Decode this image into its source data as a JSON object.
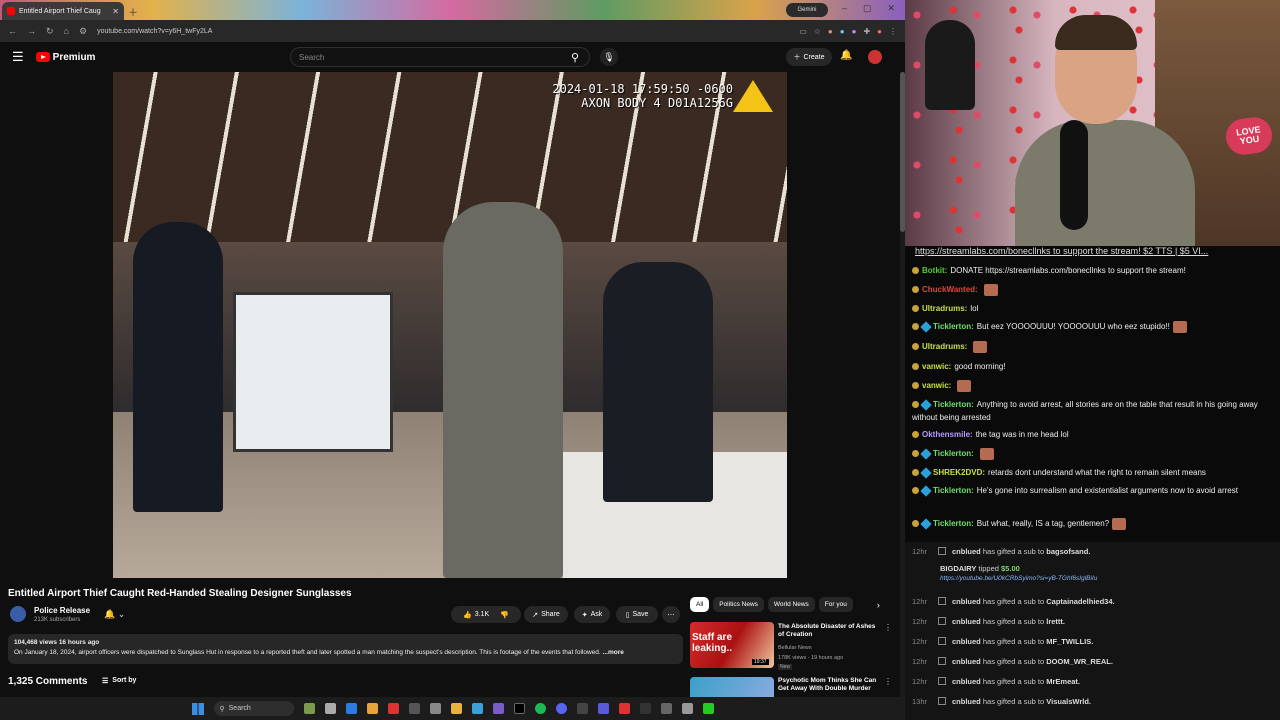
{
  "browser": {
    "tab_title": "Entitled Airport Thief Caug",
    "url": "youtube.com/watch?v=y6H_twFy2LA",
    "gemini_label": "Gemini"
  },
  "youtube": {
    "brand": "Premium",
    "search_placeholder": "Search",
    "create_label": "Create",
    "video": {
      "timestamp_line1": "2024-01-18 17:59:50 -0600",
      "timestamp_line2": "AXON BODY 4 D01A1256G",
      "title": "Entitled Airport Thief Caught Red-Handed Stealing Designer Sunglasses"
    },
    "channel": {
      "name": "Police Release",
      "subs": "213K subscribers"
    },
    "actions": {
      "likes": "3.1K",
      "share": "Share",
      "ask": "Ask",
      "save": "Save"
    },
    "description": {
      "meta": "104,468 views  16 hours ago",
      "text": "On January 18, 2024, airport officers were dispatched to Sunglass Hut in response to a reported theft and later spotted a man matching the suspect's description. This is footage of the events that followed.",
      "more": "...more"
    },
    "comments_count": "1,325 Comments",
    "sort_by": "Sort by",
    "chips": [
      "All",
      "Politics News",
      "World News",
      "For you"
    ],
    "recs": [
      {
        "thumb_text": "Staff are leaking..",
        "duration": "19:37",
        "title": "The Absolute Disaster of Ashes of Creation",
        "channel": "Bellular News",
        "meta": "178K views · 19 hours ago",
        "badge": "New"
      },
      {
        "title": "Psychotic Mom Thinks She Can Get Away With Double Murder"
      }
    ]
  },
  "overlay": {
    "love_sign": "LOVE YOU"
  },
  "chat": {
    "ticker": "https://streamlabs.com/bonecllnks to support the stream! $2 TTS | $5 VI...",
    "messages": [
      {
        "user": "Botkit:",
        "text": "DONATE https://streamlabs.com/bonecllnks to support the stream!",
        "color": "#57c83a"
      },
      {
        "user": "ChuckWanted:",
        "text": "",
        "color": "#e0443c"
      },
      {
        "user": "Ultradrums:",
        "text": "lol",
        "color": "#c7e04a"
      },
      {
        "user": "Ticklerton:",
        "text": "But eez YOOOOUUU! YOOOOUUU who eez stupido!!",
        "color": "#6ee06a"
      },
      {
        "user": "Ultradrums:",
        "text": "",
        "color": "#c7e04a"
      },
      {
        "user": "vanwic:",
        "text": "good morning!",
        "color": "#c7e04a"
      },
      {
        "user": "vanwic:",
        "text": "",
        "color": "#c7e04a"
      },
      {
        "user": "Ticklerton:",
        "text": "Anything to avoid arrest, all stories are on the table that result in his going away without being arrested",
        "color": "#6ee06a"
      },
      {
        "user": "Okthensmile:",
        "text": "the tag was in me head lol",
        "color": "#b59bff"
      },
      {
        "user": "Ticklerton:",
        "text": "",
        "color": "#6ee06a"
      },
      {
        "user": "SHREK2DVD:",
        "text": "retards dont understand what the right to remain silent means",
        "color": "#c7e04a"
      },
      {
        "user": "Ticklerton:",
        "text": "He's gone into surrealism and existentialist arguments now to avoid arrest",
        "color": "#6ee06a"
      },
      {
        "user": "Ticklerton:",
        "text": "But what, really, IS a tag, gentlemen?",
        "color": "#6ee06a"
      }
    ]
  },
  "events": {
    "first": {
      "time": "12hr",
      "user": "cnblued",
      "text": "has gifted a sub to",
      "target": "bagsofsand."
    },
    "tip": {
      "user": "BIGDAIRY",
      "action": "tipped",
      "amount": "$5.00",
      "link": "https://youtube.be/U0kCRbSyimo?si=yB-TGhf6sIglBiIu"
    },
    "gifts": [
      {
        "time": "12hr",
        "user": "cnblued",
        "text": "has gifted a sub to",
        "target": "Captainadelhied34."
      },
      {
        "time": "12hr",
        "user": "cnblued",
        "text": "has gifted a sub to",
        "target": "lrettt."
      },
      {
        "time": "12hr",
        "user": "cnblued",
        "text": "has gifted a sub to",
        "target": "MF_TWILLIS."
      },
      {
        "time": "12hr",
        "user": "cnblued",
        "text": "has gifted a sub to",
        "target": "DOOM_WR_REAL."
      },
      {
        "time": "12hr",
        "user": "cnblued",
        "text": "has gifted a sub to",
        "target": "MrEmeat."
      },
      {
        "time": "13hr",
        "user": "cnblued",
        "text": "has gifted a sub to",
        "target": "VisualsWrld."
      }
    ]
  },
  "taskbar": {
    "search_label": "Search"
  }
}
